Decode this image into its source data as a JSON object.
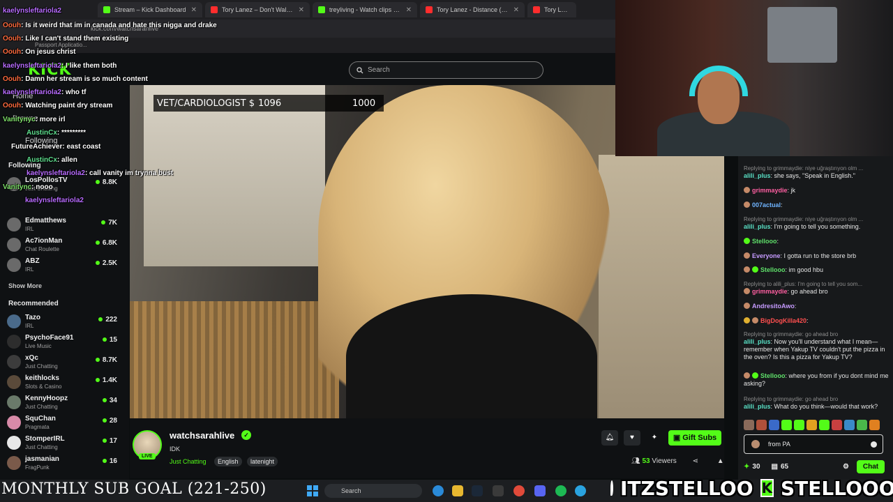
{
  "browser": {
    "tabs": [
      {
        "label": "Stream – Kick Dashboard",
        "favicon": "kick"
      },
      {
        "label": "Tory Lanez – Don't Walk Away...",
        "favicon": "youtube"
      },
      {
        "label": "treyliving - Watch clips on Kick",
        "favicon": "kick"
      },
      {
        "label": "Tory Lanez - Distance (Official...",
        "favicon": "youtube"
      },
      {
        "label": "Tory Lanez and T",
        "favicon": "youtube"
      }
    ],
    "url": "kick.com/watchsarahlive",
    "bookmark": "Passport Applicatio..."
  },
  "header": {
    "logo": "KICK",
    "search_placeholder": "Search"
  },
  "sidebar": {
    "nav": [
      "Home",
      "Browse",
      "Following"
    ],
    "following_label": "Following",
    "following": [
      {
        "name": "LosPollosTV",
        "category": "Just Chatting",
        "viewers": "8.8K"
      },
      {
        "name": "Edmatthews",
        "category": "IRL",
        "viewers": "7K"
      },
      {
        "name": "Ac7ionMan",
        "category": "Chat Roulette",
        "viewers": "6.8K"
      },
      {
        "name": "ABZ",
        "category": "IRL",
        "viewers": "2.5K"
      }
    ],
    "show_more": "Show More",
    "recommended_label": "Recommended",
    "recommended": [
      {
        "name": "Tazo",
        "category": "IRL",
        "viewers": "222"
      },
      {
        "name": "PsychoFace91",
        "category": "Live Music",
        "viewers": "15"
      },
      {
        "name": "xQc",
        "category": "Just Chatting",
        "viewers": "8.7K"
      },
      {
        "name": "keithlocks",
        "category": "Slots & Casino",
        "viewers": "1.4K"
      },
      {
        "name": "KennyHoopz",
        "category": "Just Chatting",
        "viewers": "34"
      },
      {
        "name": "SquChan",
        "category": "Pragmata",
        "viewers": "28"
      },
      {
        "name": "StomperIRL",
        "category": "Just Chatting",
        "viewers": "17"
      },
      {
        "name": "jasmanian",
        "category": "FragPunk",
        "viewers": "16"
      }
    ]
  },
  "overlay_chat": [
    {
      "user": "kaelynsleftariola2",
      "text": ""
    },
    {
      "user": "Oouh",
      "text": ": Is it weird that im in canada and hate this nigga and drake"
    },
    {
      "user": "Oouh",
      "text": ": Like I can't stand them existing"
    },
    {
      "user": "Oouh",
      "text": ": On jesus christ"
    },
    {
      "user": "kaelynsleftariola2",
      "text": ": I like them both"
    },
    {
      "user": "Oouh",
      "text": ": Damn her stream is so much content"
    },
    {
      "user": "kaelynsleftariola2",
      "text": ": who tf"
    },
    {
      "user": "Oouh",
      "text": ": Watching paint dry stream"
    },
    {
      "user": "Vanitynyc",
      "text": ": more irl"
    },
    {
      "user": "AustinCx",
      "text": ": *********"
    },
    {
      "user": "FutureAchiever",
      "text": ": east coast"
    },
    {
      "user": "AustinCx",
      "text": ": allen"
    },
    {
      "user": "kaelynsleftariola2",
      "text": ": call vanity im trynna bust"
    },
    {
      "user": "Vanitync",
      "text": ": nooo"
    },
    {
      "user": "kaelynsleftariola2",
      "text": ""
    }
  ],
  "video": {
    "ticker_label": "VET/CARDIOLOGIST $",
    "ticker_value": "1096",
    "ticker_goal": "1000"
  },
  "stream": {
    "name": "watchsarahlive",
    "live": "LIVE",
    "title": "IDK",
    "category": "Just Chatting",
    "tags": [
      "English",
      "latenight"
    ],
    "gift_label": "Gift Subs",
    "viewers_count": "53",
    "viewers_label": "Viewers"
  },
  "chat": {
    "messages": [
      {
        "reply": "Replying to grimmaydie: niye uğraştırıyon olm ...",
        "user": "alili_plus",
        "text": ": she says, \"Speak in English.\""
      },
      {
        "reply": "",
        "user": "grimmaydie",
        "text": ": jk"
      },
      {
        "reply": "",
        "user": "007actual",
        "text": ":"
      },
      {
        "reply": "Replying to grimmaydie: niye uğraştırıyon olm ...",
        "user": "alili_plus",
        "text": ": I'm going to tell you something."
      },
      {
        "reply": "",
        "user": "Stellooo",
        "text": ":"
      },
      {
        "reply": "",
        "user": "Everyone",
        "text": ": I gotta run to the store brb"
      },
      {
        "reply": "",
        "user": "Stellooo",
        "text": ": im good hbu"
      },
      {
        "reply": "Replying to alili_plus: I'm going to tell you som...",
        "user": "grimmaydie",
        "text": ": go ahead bro"
      },
      {
        "reply": "",
        "user": "AndresitoAwo",
        "text": ":"
      },
      {
        "reply": "",
        "user": "BigDogKilla420",
        "text": ":"
      },
      {
        "reply": "Replying to grimmaydie: go ahead bro",
        "user": "alili_plus",
        "text": ": Now you'll understand what I mean—remember when Yakup TV couldn't put the pizza in the oven? Is this a pizza for Yakup TV?"
      },
      {
        "reply": "",
        "user": "Stellooo",
        "text": ": where you from if you dont mind me asking?"
      },
      {
        "reply": "Replying to grimmaydie: go ahead bro",
        "user": "alili_plus",
        "text": ": What do you think—would that work?"
      }
    ],
    "input_value": "from PA",
    "points": "30",
    "store_count": "65",
    "chat_button": "Chat"
  },
  "overlay": {
    "sub_goal": "MONTHLY SUB GOAL (221-250)",
    "twitter_handle": "ITZSTELLOO",
    "kick_handle": "STELLOOO"
  },
  "taskbar": {
    "search_label": "Search"
  },
  "colors": {
    "kick_green": "#53fc18",
    "background": "#0b0e0f"
  }
}
